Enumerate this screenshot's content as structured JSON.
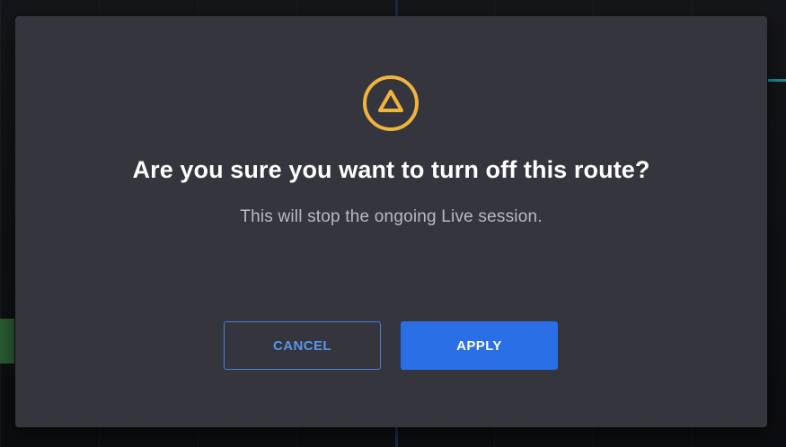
{
  "dialog": {
    "icon": "warning-triangle-icon",
    "title": "Are you sure you want to turn off this route?",
    "message": "This will stop the ongoing Live session.",
    "cancel_label": "CANCEL",
    "apply_label": "APPLY"
  },
  "colors": {
    "modal_background": "#34353d",
    "warning_accent": "#f0b43c",
    "primary_button": "#2b6fe6",
    "secondary_button_border": "#4a7fd8"
  }
}
